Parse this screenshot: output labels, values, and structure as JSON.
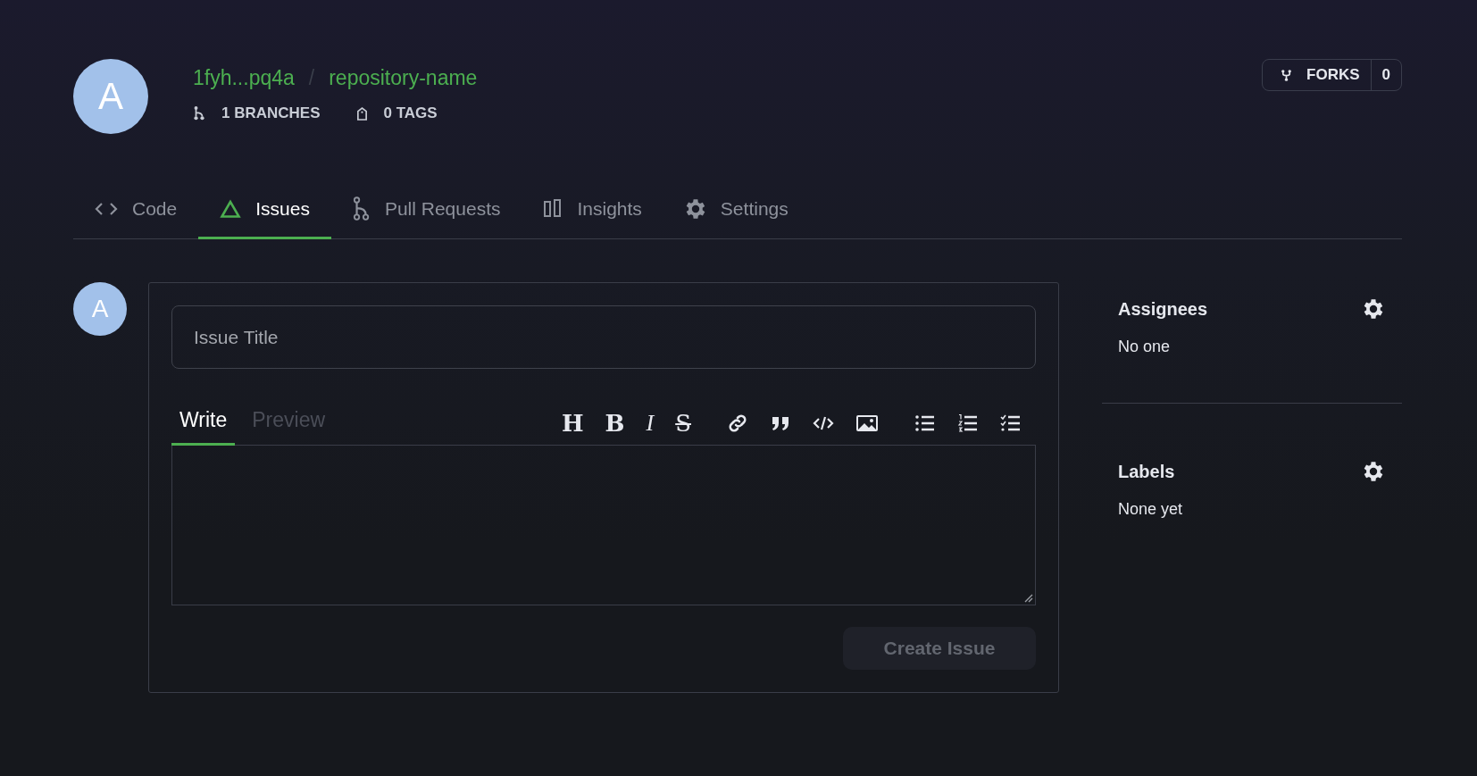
{
  "repo": {
    "avatar_letter": "A",
    "owner": "1fyh...pq4a",
    "separator": "/",
    "name": "repository-name",
    "branches": "1 BRANCHES",
    "tags": "0 TAGS"
  },
  "forks": {
    "label": "FORKS",
    "count": "0"
  },
  "tabs": [
    {
      "kind": "code",
      "label": "Code",
      "selected": false
    },
    {
      "kind": "issues",
      "label": "Issues",
      "selected": true
    },
    {
      "kind": "pulls",
      "label": "Pull Requests",
      "selected": false
    },
    {
      "kind": "insights",
      "label": "Insights",
      "selected": false
    },
    {
      "kind": "settings",
      "label": "Settings",
      "selected": false
    }
  ],
  "form": {
    "avatar_letter": "A",
    "title_placeholder": "Issue Title",
    "editor_tabs": [
      {
        "label": "Write",
        "selected": true
      },
      {
        "label": "Preview",
        "selected": false
      }
    ],
    "toolbar": [
      [
        {
          "kind": "heading",
          "glyph": "H"
        },
        {
          "kind": "bold",
          "glyph": "B"
        },
        {
          "kind": "italic",
          "glyph": "I"
        },
        {
          "kind": "strike",
          "glyph": "S"
        }
      ],
      [
        {
          "kind": "link"
        },
        {
          "kind": "quote"
        },
        {
          "kind": "code"
        },
        {
          "kind": "image"
        }
      ],
      [
        {
          "kind": "ul"
        },
        {
          "kind": "ol"
        },
        {
          "kind": "tasks"
        }
      ]
    ],
    "submit": {
      "label": "Create Issue",
      "disabled": true
    }
  },
  "sidebar": [
    {
      "title": "Assignees",
      "value": "No one"
    },
    {
      "title": "Labels",
      "value": "None yet"
    }
  ]
}
